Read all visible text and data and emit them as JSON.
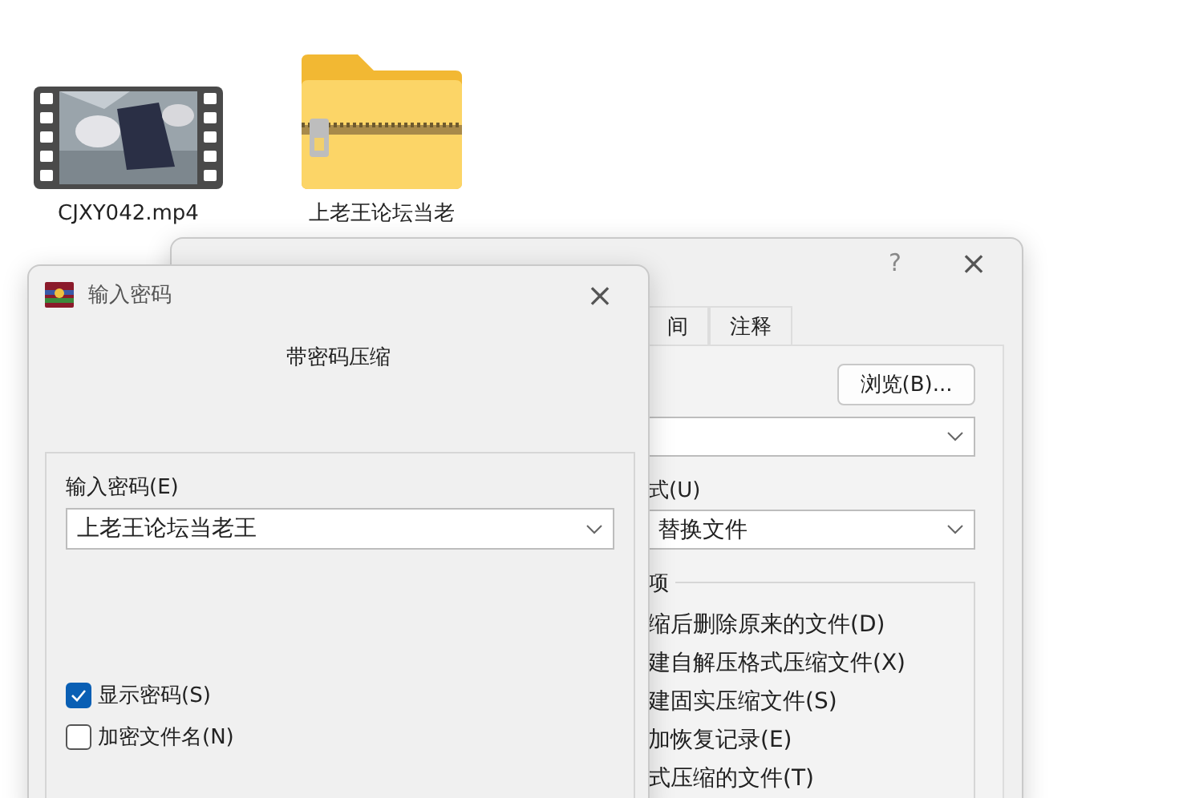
{
  "desktop_icons": [
    {
      "kind": "video",
      "label": "CJXY042.mp4"
    },
    {
      "kind": "zip",
      "label": "上老王论坛当老"
    }
  ],
  "archive_dialog": {
    "help": "?",
    "close": "×",
    "tabs": [
      {
        "label": "间",
        "selected": false
      },
      {
        "label": "注释",
        "selected": false
      }
    ],
    "browse_button": "浏览(B)...",
    "update_label": "式(U)",
    "update_value": "替换文件",
    "options_label": "项",
    "options": [
      "缩后删除原来的文件(D)",
      "建自解压格式压缩文件(X)",
      "建固实压缩文件(S)",
      "加恢复记录(E)",
      "式压缩的文件(T)"
    ]
  },
  "password_dialog": {
    "title": "输入密码",
    "close": "×",
    "heading": "带密码压缩",
    "password_label": "输入密码(E)",
    "password_value": "上老王论坛当老王",
    "checkboxes": [
      {
        "label": "显示密码(S)",
        "checked": true
      },
      {
        "label": "加密文件名(N)",
        "checked": false
      }
    ]
  }
}
